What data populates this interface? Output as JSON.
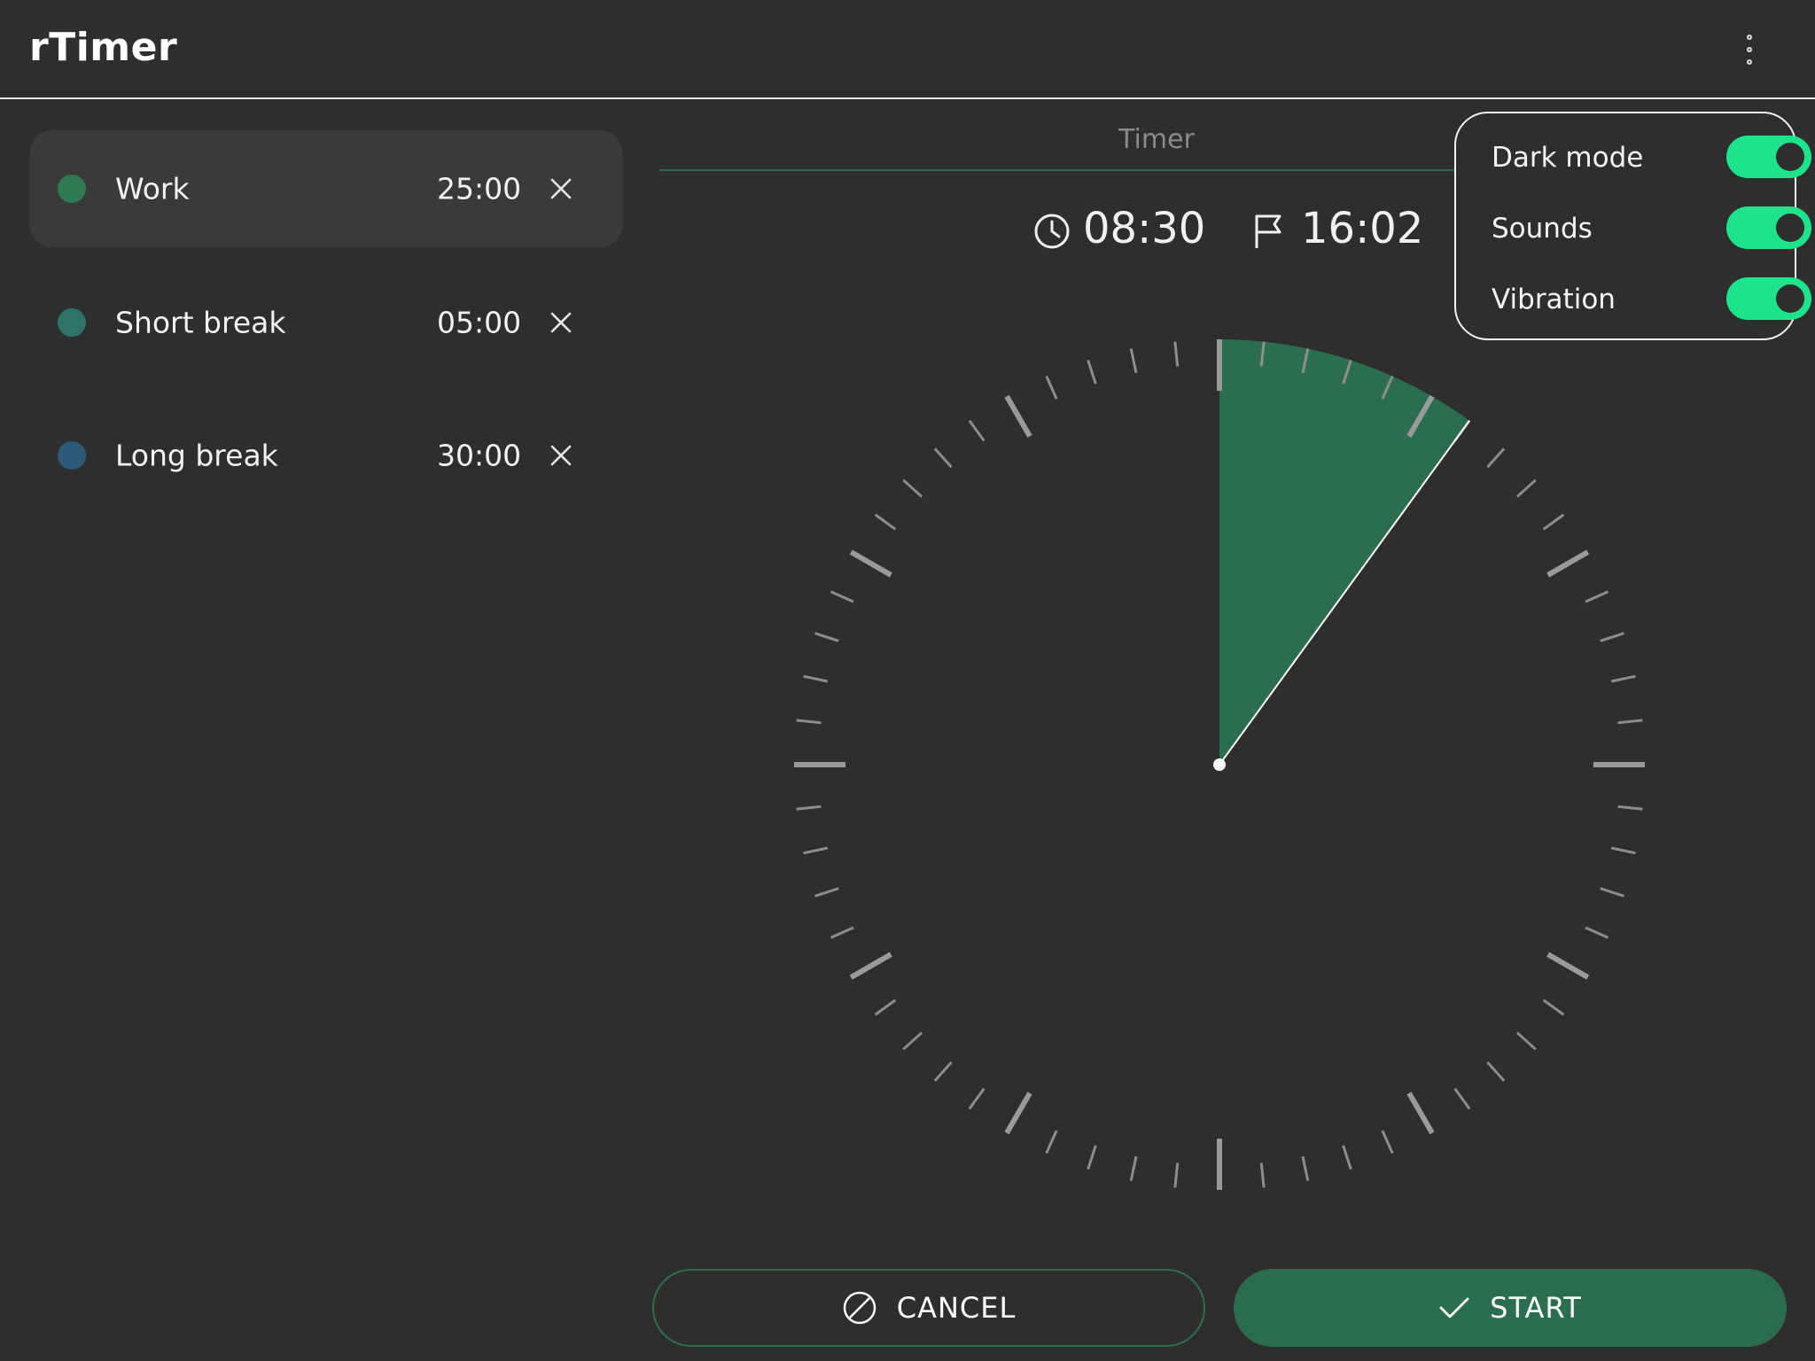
{
  "app": {
    "title": "rTimer"
  },
  "presets": [
    {
      "label": "Work",
      "duration": "25:00",
      "color": "#2f7a52",
      "selected": true
    },
    {
      "label": "Short break",
      "duration": "05:00",
      "color": "#2e7466",
      "selected": false
    },
    {
      "label": "Long break",
      "duration": "30:00",
      "color": "#2d5a78",
      "selected": false
    }
  ],
  "timer": {
    "tab_label": "Timer",
    "start_time": "08:30",
    "end_time": "16:02",
    "dial_fill_fraction": 0.1,
    "fill_color": "#2b6e4f"
  },
  "settings": {
    "items": [
      {
        "label": "Dark mode",
        "on": true
      },
      {
        "label": "Sounds",
        "on": true
      },
      {
        "label": "Vibration",
        "on": true
      }
    ],
    "toggle_color": "#1de38a"
  },
  "actions": {
    "cancel_label": "CANCEL",
    "start_label": "START"
  },
  "icons": {
    "menu": "more-vert-icon",
    "remove": "close-icon",
    "start_time": "clock-icon",
    "end_time": "flag-icon",
    "cancel": "block-icon",
    "start": "check-icon"
  }
}
